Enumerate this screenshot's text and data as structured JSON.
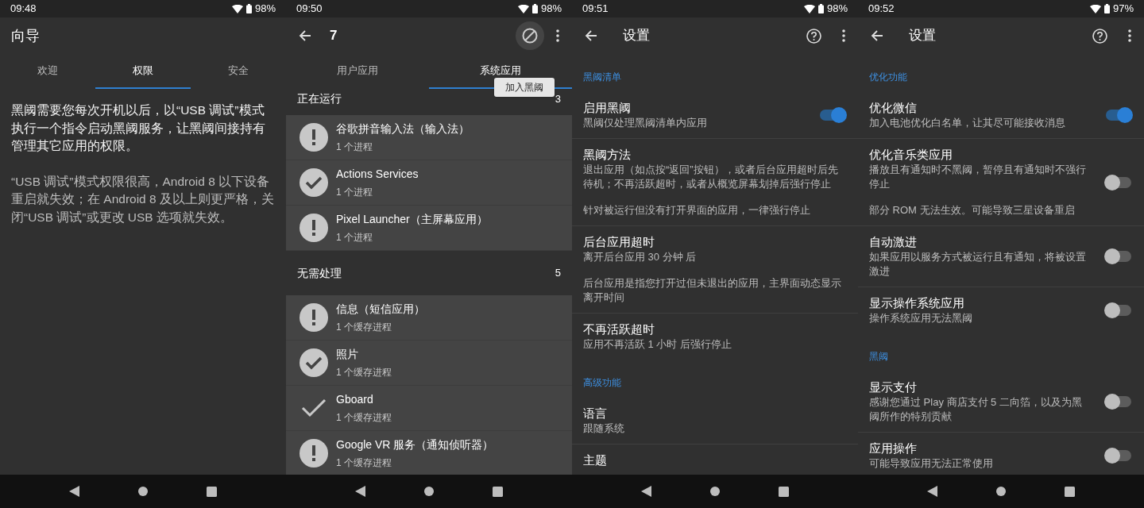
{
  "screens": [
    {
      "kind": "guide",
      "status": {
        "time": "09:48",
        "battery": "98%"
      },
      "title": "向导",
      "tabs": [
        {
          "label": "欢迎",
          "selected": false
        },
        {
          "label": "权限",
          "selected": true
        },
        {
          "label": "安全",
          "selected": false
        }
      ],
      "paragraphs": [
        {
          "kind": "primary",
          "text": "黑阈需要您每次开机以后，以“USB 调试”模式执行一个指令启动黑阈服务，让黑阈间接持有管理其它应用的权限。"
        },
        {
          "kind": "secondary",
          "text": "“USB 调试”模式权限很高，Android 8 以下设备重启就失效；在 Android 8 及以上则更严格，关闭“USB 调试”或更改 USB 选项就失效。"
        }
      ]
    },
    {
      "kind": "apps",
      "status": {
        "time": "09:50",
        "battery": "98%"
      },
      "title": "7",
      "tooltip": "加入黑阈",
      "tabs": [
        {
          "label": "用户应用",
          "selected": false
        },
        {
          "label": "系统应用",
          "selected": true
        }
      ],
      "sections": [
        {
          "title": "正在运行",
          "count": "3",
          "apps": [
            {
              "name": "谷歌拼音输入法（输入法）",
              "detail": "1 个进程",
              "kind": "alert"
            },
            {
              "name": "Actions Services",
              "detail": "1 个进程",
              "kind": "check_circle"
            },
            {
              "name": "Pixel Launcher（主屏幕应用）",
              "detail": "1 个进程",
              "kind": "alert"
            }
          ]
        },
        {
          "title": "无需处理",
          "count": "5",
          "apps": [
            {
              "name": "信息（短信应用）",
              "detail": "1 个缓存进程",
              "kind": "alert"
            },
            {
              "name": "照片",
              "detail": "1 个缓存进程",
              "kind": "check_circle"
            },
            {
              "name": "Gboard",
              "detail": "1 个缓存进程",
              "kind": "check"
            },
            {
              "name": "Google VR 服务（通知侦听器）",
              "detail": "1 个缓存进程",
              "kind": "alert"
            }
          ]
        }
      ]
    },
    {
      "kind": "settings",
      "status": {
        "time": "09:51",
        "battery": "98%"
      },
      "title": "设置",
      "items": [
        {
          "kind": "header",
          "title": "黑阈清单"
        },
        {
          "kind": "pref",
          "title": "启用黑阈",
          "summary": "黑阈仅处理黑阈清单内应用",
          "toggle": {
            "on": true
          }
        },
        {
          "kind": "pref",
          "title": "黑阈方法",
          "summary": "退出应用（如点按“返回”按钮），或者后台应用超时后先待机；不再活跃超时，或者从概览屏幕划掉后强行停止",
          "note": "针对被运行但没有打开界面的应用，一律强行停止"
        },
        {
          "kind": "pref",
          "title": "后台应用超时",
          "summary": "离开后台应用 30 分钟 后",
          "note": "后台应用是指您打开过但未退出的应用，主界面动态显示离开时间"
        },
        {
          "kind": "pref",
          "title": "不再活跃超时",
          "summary": "应用不再活跃 1 小时 后强行停止"
        },
        {
          "kind": "header",
          "title": "高级功能"
        },
        {
          "kind": "pref",
          "title": "语言",
          "summary": "跟随系统"
        },
        {
          "kind": "pref",
          "title": "主题"
        }
      ]
    },
    {
      "kind": "settings",
      "status": {
        "time": "09:52",
        "battery": "97%"
      },
      "title": "设置",
      "items": [
        {
          "kind": "header",
          "title": "优化功能"
        },
        {
          "kind": "pref",
          "title": "优化微信",
          "summary": "加入电池优化白名单，让其尽可能接收消息",
          "toggle": {
            "on": true
          }
        },
        {
          "kind": "pref",
          "title": "优化音乐类应用",
          "summary": "播放且有通知时不黑阈，暂停且有通知时不强行停止",
          "note": "部分 ROM 无法生效。可能导致三星设备重启",
          "toggle": {
            "on": false
          }
        },
        {
          "kind": "pref",
          "title": "自动激进",
          "summary": "如果应用以服务方式被运行且有通知，将被设置激进",
          "toggle": {
            "on": false
          }
        },
        {
          "kind": "pref",
          "title": "显示操作系统应用",
          "summary": "操作系统应用无法黑阈",
          "toggle": {
            "on": false
          }
        },
        {
          "kind": "header",
          "title": "黑阈"
        },
        {
          "kind": "pref",
          "title": "显示支付",
          "summary": "感谢您通过 Play 商店支付 5 二向箔，以及为黑阈所作的特别贡献",
          "toggle": {
            "on": false
          }
        },
        {
          "kind": "pref",
          "title": "应用操作",
          "summary": "可能导致应用无法正常使用",
          "toggle": {
            "on": false
          }
        }
      ]
    }
  ]
}
